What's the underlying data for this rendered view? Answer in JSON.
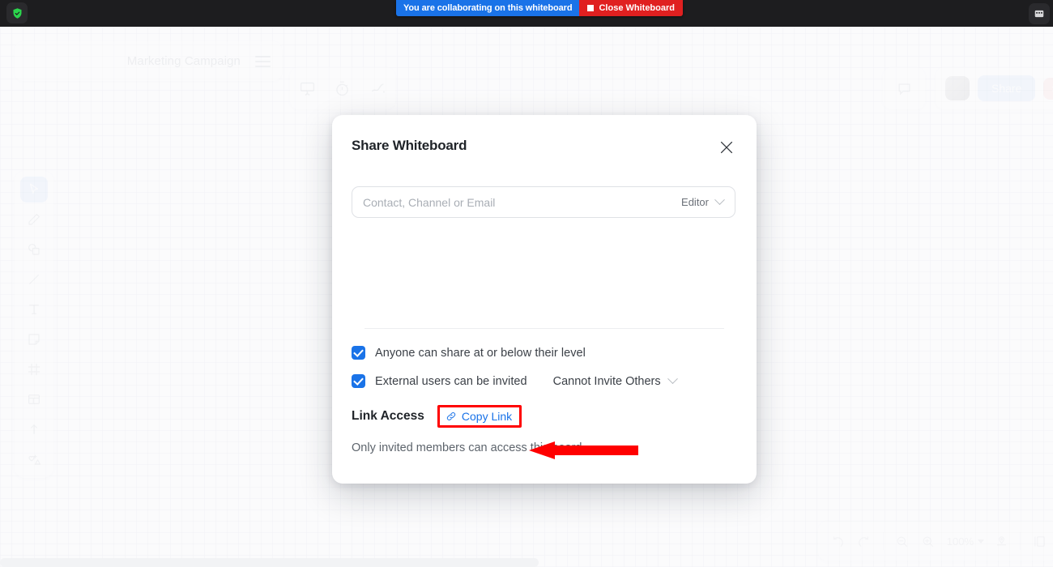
{
  "os_bar": {
    "shield_icon": "shield-check-icon",
    "window_icon": "window-restore-icon",
    "banner": {
      "message": "You are collaborating on this whiteboard",
      "close_label": "Close Whiteboard",
      "stop_icon": "stop-square-icon",
      "message_bg": "#1a73e8",
      "close_bg": "#e02020"
    }
  },
  "topbar": {
    "board_title": "Marketing Campaign",
    "menu_icon": "hamburger-menu-icon",
    "mode_icons": [
      "presentation-screen-icon",
      "timer-icon",
      "laser-pointer-icon"
    ],
    "comment_icon": "comment-bubble-icon",
    "share_label": "Share",
    "close_label": "×",
    "share_bg": "#bcd6f7",
    "close_bg": "#f6c8c8"
  },
  "tool_rail": {
    "tools": [
      {
        "name": "select-cursor-icon",
        "active": true
      },
      {
        "name": "pen-icon",
        "active": false
      },
      {
        "name": "shapes-icon",
        "active": false
      },
      {
        "name": "line-icon",
        "active": false
      },
      {
        "name": "text-icon",
        "active": false
      },
      {
        "name": "sticky-note-icon",
        "active": false
      },
      {
        "name": "frame-icon",
        "active": false
      },
      {
        "name": "template-icon",
        "active": false
      },
      {
        "name": "upload-icon",
        "active": false
      },
      {
        "name": "more-tools-icon",
        "active": false
      }
    ],
    "active_color": "#bcd6f7"
  },
  "zoom_bar": {
    "undo_icon": "undo-arrow-icon",
    "redo_icon": "redo-arrow-icon",
    "zoom_out_icon": "zoom-out-icon",
    "zoom_in_icon": "zoom-in-icon",
    "zoom_level": "100%",
    "locate_icon": "locate-pin-icon",
    "panels_icon": "panels-icon"
  },
  "dialog": {
    "title": "Share Whiteboard",
    "close_icon": "close-x-icon",
    "recipient": {
      "placeholder": "Contact, Channel or Email",
      "value": "",
      "role": "Editor",
      "role_chevron": "chevron-down-icon"
    },
    "options": [
      {
        "label": "Anyone can share at or below their level",
        "checked": true
      },
      {
        "label": "External users can be invited",
        "checked": true
      }
    ],
    "invite_select": {
      "value": "Cannot Invite Others",
      "chevron": "chevron-down-icon"
    },
    "link_access": {
      "label": "Link Access",
      "copy_link_label": "Copy Link",
      "copy_link_icon": "link-chain-icon",
      "highlight_color": "#ff0000",
      "link_color": "#1a73e8"
    },
    "board_access": {
      "value": "Only invited members can access this board",
      "chevron": "chevron-down-icon"
    },
    "checkbox_color": "#1a73e8"
  },
  "annotation": {
    "arrow_icon": "red-pointer-arrow",
    "arrow_color": "#ff0000"
  }
}
